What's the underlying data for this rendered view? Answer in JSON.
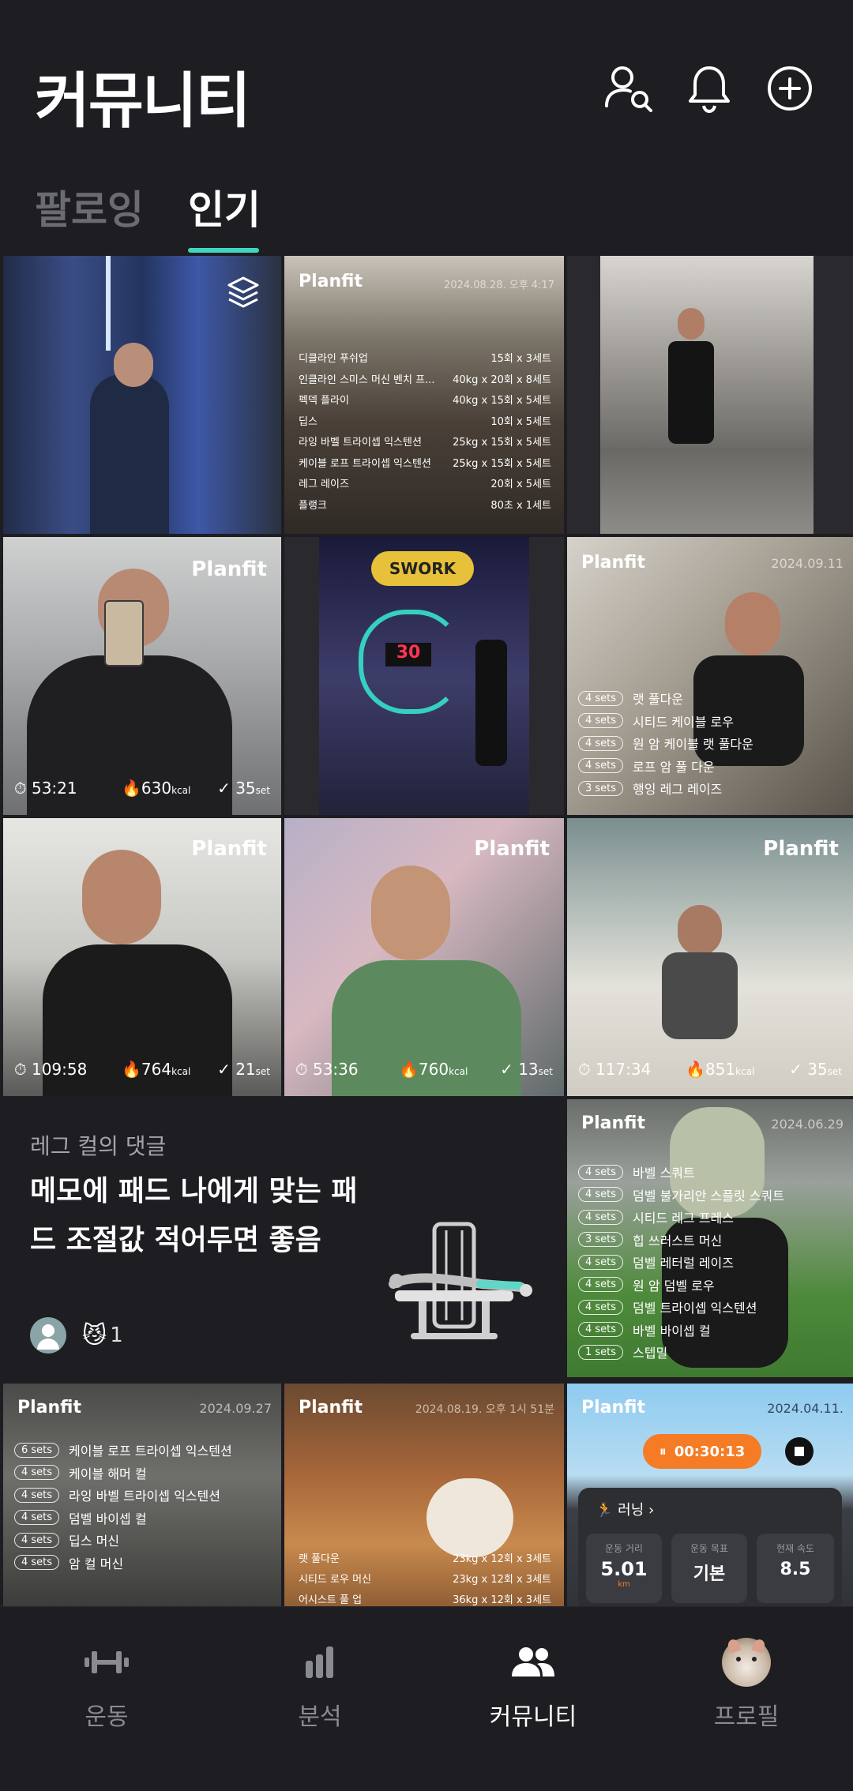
{
  "header": {
    "title": "커뮤니티",
    "icons": [
      "user-search-icon",
      "bell-icon",
      "add-circle-icon"
    ]
  },
  "tabs": [
    {
      "label": "팔로잉",
      "active": false
    },
    {
      "label": "인기",
      "active": true
    }
  ],
  "posts": [
    {
      "id": "p1",
      "kind": "photo-multi"
    },
    {
      "id": "p2",
      "brand": "Planfit",
      "date": "2024.08.28. 오후 4:17",
      "exercises": [
        {
          "name": "디클라인 푸쉬업",
          "detail": "15회 x 3세트"
        },
        {
          "name": "인클라인 스미스 머신 벤치 프...",
          "detail": "40kg x 20회 x 8세트"
        },
        {
          "name": "펙덱 플라이",
          "detail": "40kg x 15회 x 5세트"
        },
        {
          "name": "딥스",
          "detail": "10회 x 5세트"
        },
        {
          "name": "라잉 바벨 트라이셉 익스텐션",
          "detail": "25kg x 15회 x 5세트"
        },
        {
          "name": "케이블 로프 트라이셉 익스텐션",
          "detail": "25kg x 15회 x 5세트"
        },
        {
          "name": "레그 레이즈",
          "detail": "20회 x 5세트"
        },
        {
          "name": "플랭크",
          "detail": "80초 x 1세트"
        }
      ]
    },
    {
      "id": "p3",
      "kind": "photo"
    },
    {
      "id": "p4",
      "brand": "Planfit",
      "time": "53:21",
      "kcal": "630",
      "kcal_unit": "kcal",
      "sets": "35",
      "sets_unit": "set"
    },
    {
      "id": "p5",
      "kind": "photo",
      "logo": "SWORK",
      "display": "30"
    },
    {
      "id": "p6",
      "brand": "Planfit",
      "date": "2024.09.11",
      "exercises": [
        {
          "sets": "4 sets",
          "name": "랫 풀다운"
        },
        {
          "sets": "4 sets",
          "name": "시티드 케이블 로우"
        },
        {
          "sets": "4 sets",
          "name": "원 암 케이블 랫 풀다운"
        },
        {
          "sets": "4 sets",
          "name": "로프 암 풀 다운"
        },
        {
          "sets": "3 sets",
          "name": "행잉 레그 레이즈"
        }
      ]
    },
    {
      "id": "p7",
      "brand": "Planfit",
      "time": "109:58",
      "kcal": "764",
      "kcal_unit": "kcal",
      "sets": "21",
      "sets_unit": "set"
    },
    {
      "id": "p8",
      "brand": "Planfit",
      "time": "53:36",
      "kcal": "760",
      "kcal_unit": "kcal",
      "sets": "13",
      "sets_unit": "set"
    },
    {
      "id": "p9",
      "brand": "Planfit",
      "time": "117:34",
      "kcal": "851",
      "kcal_unit": "kcal",
      "sets": "35",
      "sets_unit": "set"
    },
    {
      "id": "p11",
      "brand": "Planfit",
      "date": "2024.06.29",
      "exercises": [
        {
          "sets": "4 sets",
          "name": "바벨 스쿼트"
        },
        {
          "sets": "4 sets",
          "name": "덤벨 불가리안 스플릿 스쿼트"
        },
        {
          "sets": "4 sets",
          "name": "시티드 레그 프레스"
        },
        {
          "sets": "3 sets",
          "name": "힙 쓰러스트 머신"
        },
        {
          "sets": "4 sets",
          "name": "덤벨 레터럴 레이즈"
        },
        {
          "sets": "4 sets",
          "name": "원 암 덤벨 로우"
        },
        {
          "sets": "4 sets",
          "name": "덤벨 트라이셉 익스텐션"
        },
        {
          "sets": "4 sets",
          "name": "바벨 바이셉 컬"
        },
        {
          "sets": "1 sets",
          "name": "스텝밀"
        }
      ]
    },
    {
      "id": "p12",
      "brand": "Planfit",
      "date": "2024.09.27",
      "exercises": [
        {
          "sets": "6 sets",
          "name": "케이블 로프 트라이셉 익스텐션"
        },
        {
          "sets": "4 sets",
          "name": "케이블 해머 컬"
        },
        {
          "sets": "4 sets",
          "name": "라잉 바벨 트라이셉 익스텐션"
        },
        {
          "sets": "4 sets",
          "name": "덤벨 바이셉 컬"
        },
        {
          "sets": "4 sets",
          "name": "딥스 머신"
        },
        {
          "sets": "4 sets",
          "name": "암 컬 머신"
        }
      ]
    },
    {
      "id": "p13",
      "brand": "Planfit",
      "date": "2024.08.19. 오후 1시 51분",
      "exercises": [
        {
          "name": "랫 풀다운",
          "detail": "23kg x 12회 x 3세트"
        },
        {
          "name": "시티드 로우 머신",
          "detail": "23kg x 12회 x 3세트"
        },
        {
          "name": "어시스트 풀 업",
          "detail": "36kg x 12회 x 3세트"
        }
      ]
    },
    {
      "id": "p14",
      "brand": "Planfit",
      "date": "2024.04.11.",
      "timer": "00:30:13",
      "run_label": "러닝",
      "stats": [
        {
          "label": "운동 거리",
          "value": "5.01",
          "unit": "km"
        },
        {
          "label": "운동 목표",
          "value": "기본"
        },
        {
          "label": "현재 속도",
          "value": "8.5"
        }
      ]
    }
  ],
  "comment_card": {
    "label": "레그 컬의 댓글",
    "body": "메모에 패드 나에게 맞는 패드 조절값 적어두면 좋음",
    "reaction_count": "1",
    "reaction_emoji": "😼"
  },
  "nav": [
    {
      "label": "운동",
      "icon": "dumbbell-icon",
      "active": false
    },
    {
      "label": "분석",
      "icon": "bar-chart-icon",
      "active": false
    },
    {
      "label": "커뮤니티",
      "icon": "people-icon",
      "active": true
    },
    {
      "label": "프로필",
      "icon": "avatar-icon",
      "active": false
    }
  ],
  "colors": {
    "background": "#1d1d22",
    "accent": "#3fd6c0",
    "inactive": "#8a8a91",
    "timer_orange": "#f57c24"
  }
}
